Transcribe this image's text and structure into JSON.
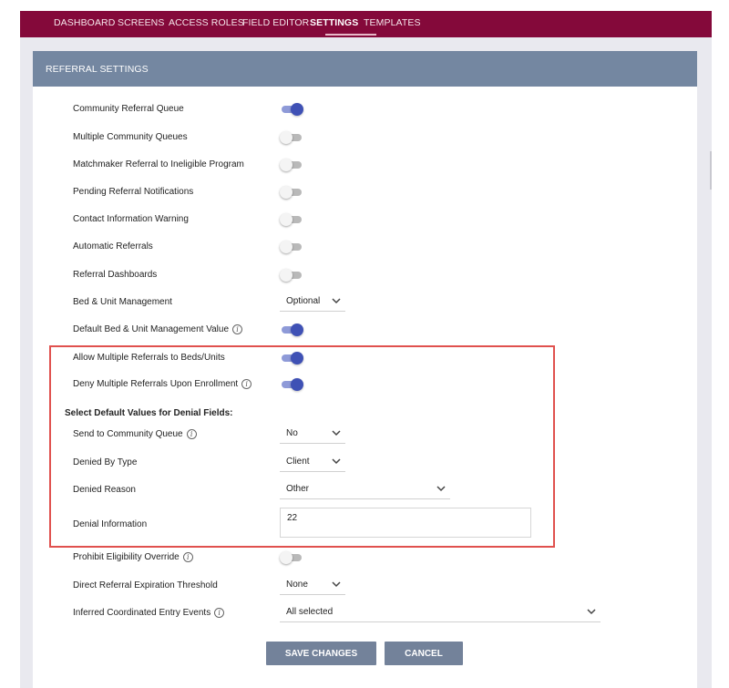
{
  "nav": {
    "tabs": [
      {
        "label": "DASHBOARD",
        "active": false
      },
      {
        "label": "SCREENS",
        "active": false
      },
      {
        "label": "ACCESS ROLES",
        "active": false
      },
      {
        "label": "FIELD EDITOR",
        "active": false
      },
      {
        "label": "SETTINGS",
        "active": true
      },
      {
        "label": "TEMPLATES",
        "active": false
      }
    ]
  },
  "section": {
    "title": "REFERRAL SETTINGS"
  },
  "settings": {
    "community_referral_queue": {
      "label": "Community Referral Queue",
      "on": true
    },
    "multiple_community_queues": {
      "label": "Multiple Community Queues",
      "on": false
    },
    "matchmaker_referral": {
      "label": "Matchmaker Referral to Ineligible Program",
      "on": false
    },
    "pending_referral_notifications": {
      "label": "Pending Referral Notifications",
      "on": false
    },
    "contact_information_warning": {
      "label": "Contact Information Warning",
      "on": false
    },
    "automatic_referrals": {
      "label": "Automatic Referrals",
      "on": false
    },
    "referral_dashboards": {
      "label": "Referral Dashboards",
      "on": false
    },
    "bed_unit_management": {
      "label": "Bed & Unit Management",
      "value": "Optional"
    },
    "default_bed_unit_value": {
      "label": "Default Bed & Unit Management Value",
      "on": true
    },
    "allow_multiple_referrals": {
      "label": "Allow Multiple Referrals to Beds/Units",
      "on": true
    },
    "deny_multiple_referrals": {
      "label": "Deny Multiple Referrals Upon Enrollment",
      "on": true
    },
    "denial_heading": "Select Default Values for Denial Fields:",
    "send_to_community_queue": {
      "label": "Send to Community Queue",
      "value": "No"
    },
    "denied_by_type": {
      "label": "Denied By Type",
      "value": "Client"
    },
    "denied_reason": {
      "label": "Denied Reason",
      "value": "Other"
    },
    "denial_information": {
      "label": "Denial Information",
      "value": "22"
    },
    "prohibit_eligibility_override": {
      "label": "Prohibit Eligibility Override",
      "on": false
    },
    "direct_referral_expiration": {
      "label": "Direct Referral Expiration Threshold",
      "value": "None"
    },
    "inferred_coordinated_entry": {
      "label": "Inferred Coordinated Entry Events",
      "value": "All selected"
    }
  },
  "actions": {
    "save_label": "SAVE CHANGES",
    "cancel_label": "CANCEL"
  },
  "colors": {
    "nav_bg": "#84093a",
    "header_bg": "#7487a1",
    "toggle_on": "#3f51b5",
    "button_bg": "#73829a",
    "highlight": "#e0514e"
  }
}
